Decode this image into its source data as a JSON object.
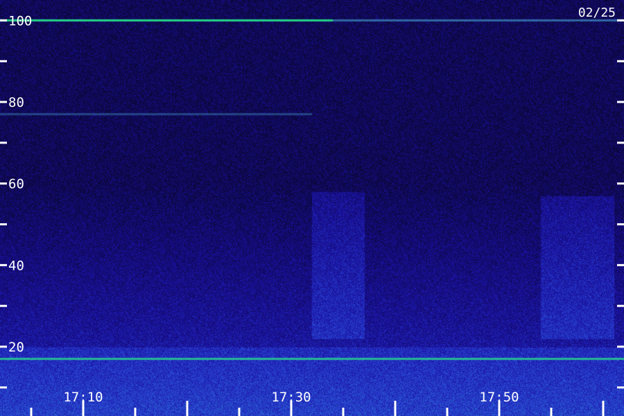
{
  "chart_data": {
    "type": "heatmap",
    "date": "02/25",
    "y_ticks": [
      "100",
      "80",
      "60",
      "40",
      "20"
    ],
    "y_tick_values": [
      100,
      80,
      60,
      40,
      20
    ],
    "y_minor_tick_values": [
      90,
      70,
      50,
      30,
      10
    ],
    "x_ticks": [
      "17:10",
      "17:30",
      "17:50"
    ],
    "x_tick_minutes": [
      10,
      30,
      50
    ],
    "x_range_minutes": [
      2,
      62
    ],
    "x_minor_tick_step": 5,
    "y_range": [
      3,
      105
    ],
    "colors": {
      "background": "#0a0630",
      "low": "#1a10a0",
      "mid": "#2a4ad8",
      "high": "#28e08c",
      "label": "#ffffff"
    },
    "features": [
      {
        "kind": "constant-line",
        "y": 100,
        "strength": 0.95,
        "x_end_minutes": 34
      },
      {
        "kind": "constant-line",
        "y": 100,
        "strength": 0.55,
        "x_start_minutes": 34
      },
      {
        "kind": "constant-line",
        "y": 17,
        "strength": 0.8
      },
      {
        "kind": "constant-line",
        "y": 77,
        "strength": 0.35,
        "x_end_minutes": 32
      },
      {
        "kind": "burst",
        "x_start_minutes": 32,
        "x_end_minutes": 37,
        "y_from": 22,
        "y_to": 58,
        "strength": 0.45
      },
      {
        "kind": "burst",
        "x_start_minutes": 54,
        "x_end_minutes": 61,
        "y_from": 22,
        "y_to": 57,
        "strength": 0.45
      }
    ]
  }
}
